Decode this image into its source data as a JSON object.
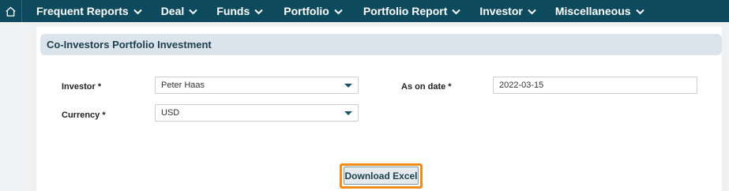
{
  "nav": {
    "home_icon": "home-icon",
    "items": [
      {
        "label": "Frequent Reports"
      },
      {
        "label": "Deal"
      },
      {
        "label": "Funds"
      },
      {
        "label": "Portfolio"
      },
      {
        "label": "Portfolio Report"
      },
      {
        "label": "Investor"
      },
      {
        "label": "Miscellaneous"
      }
    ]
  },
  "panel": {
    "title": "Co-Investors Portfolio Investment"
  },
  "form": {
    "investor_label": "Investor *",
    "investor_value": "Peter Haas",
    "currency_label": "Currency *",
    "currency_value": "USD",
    "as_on_date_label": "As on date *",
    "as_on_date_value": "2022-03-15"
  },
  "actions": {
    "download_label": "Download Excel"
  },
  "colors": {
    "nav_bg": "#0e4a5e",
    "highlight": "#f08c1a"
  }
}
